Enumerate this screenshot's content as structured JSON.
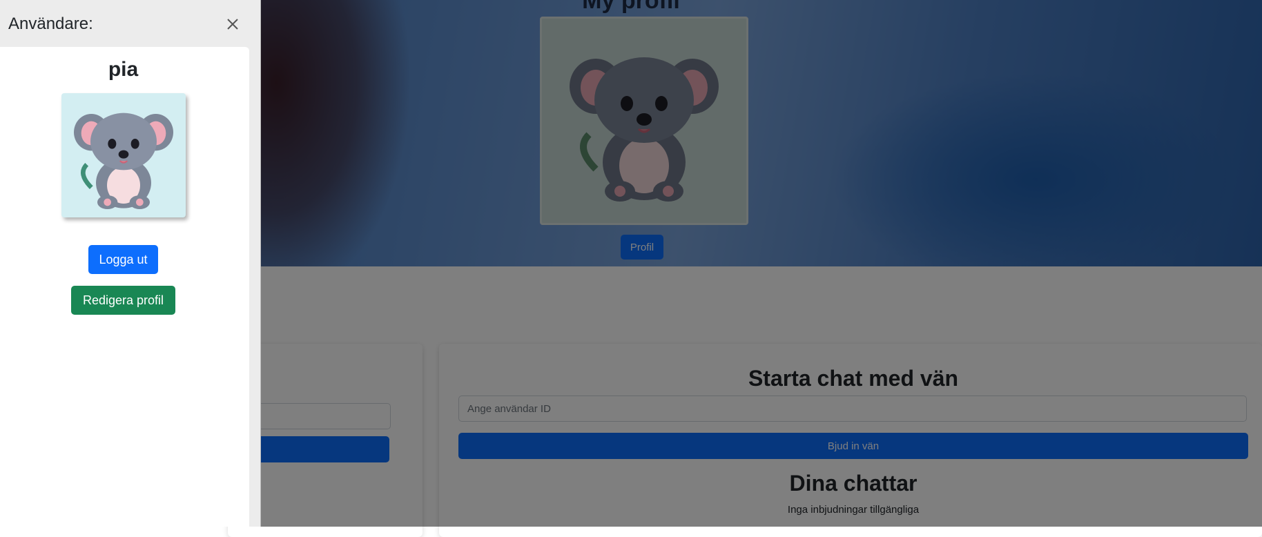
{
  "hero": {
    "title": "My profil",
    "profile_button": "Profil"
  },
  "chat_card": {
    "title": "Starta chat med vän",
    "user_id_placeholder": "Ange användar ID",
    "invite_button": "Bjud in vän",
    "chats_title": "Dina chattar",
    "empty_text": "Inga inbjudningar tillgängliga"
  },
  "offcanvas": {
    "title": "Användare:",
    "username": "pia",
    "logout_button": "Logga ut",
    "edit_profile_button": "Redigera profil"
  },
  "icons": {
    "close": "close-icon",
    "avatar": "koala-avatar-image"
  },
  "colors": {
    "primary": "#0d6efd",
    "success": "#198754",
    "backdrop": "rgba(0,0,0,0.5)"
  }
}
